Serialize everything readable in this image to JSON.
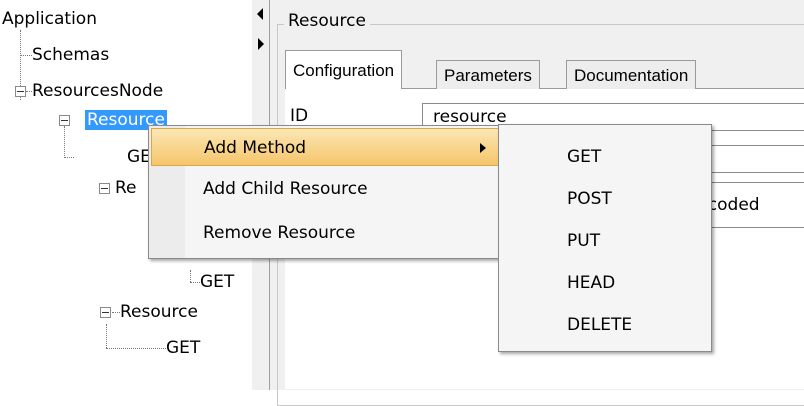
{
  "tree": {
    "root": "Application",
    "schemas": "Schemas",
    "resources_node": "ResourcesNode",
    "resource_selected": "Resource",
    "child_get_1": "GET",
    "resource_partial": "Re",
    "child_get_2": "GET",
    "resource_3": "Resource",
    "child_get_3": "GET"
  },
  "panel": {
    "group_title": "Resource",
    "tabs": [
      {
        "label": "Configuration",
        "active": true
      },
      {
        "label": "Parameters",
        "active": false
      },
      {
        "label": "Documentation",
        "active": false
      }
    ],
    "id_label": "ID",
    "id_value": "resource",
    "encoding_value": "ncoded"
  },
  "context_menu": {
    "items": [
      {
        "label": "Add Method",
        "highlighted": true,
        "has_submenu": true
      },
      {
        "label": "Add Child Resource",
        "highlighted": false
      },
      {
        "label": "Remove  Resource",
        "highlighted": false
      }
    ]
  },
  "submenu": {
    "items": [
      "GET",
      "POST",
      "PUT",
      "HEAD",
      "DELETE"
    ]
  },
  "colors": {
    "selection": "#3399ff",
    "menu_highlight": "#f5c56a",
    "pane_background": "#f0f0f0"
  }
}
